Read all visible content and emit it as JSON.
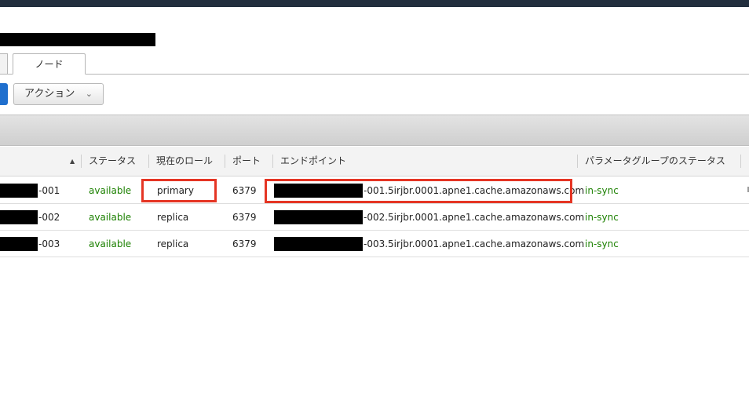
{
  "tabs": {
    "active_label": "ノード"
  },
  "toolbar": {
    "action_label": "アクション"
  },
  "table": {
    "columns": [
      "ステータス",
      "現在のロール",
      "ポート",
      "エンドポイント",
      "パラメータグループのステータス"
    ],
    "rows": [
      {
        "name_suffix": "-001",
        "status": "available",
        "role": "primary",
        "port": "6379",
        "endpoint_suffix": "-001.5irjbr.0001.apne1.cache.amazonaws.com",
        "param_status": "in-sync"
      },
      {
        "name_suffix": "-002",
        "status": "available",
        "role": "replica",
        "port": "6379",
        "endpoint_suffix": "-002.5irjbr.0001.apne1.cache.amazonaws.com",
        "param_status": "in-sync"
      },
      {
        "name_suffix": "-003",
        "status": "available",
        "role": "replica",
        "port": "6379",
        "endpoint_suffix": "-003.5irjbr.0001.apne1.cache.amazonaws.com",
        "param_status": "in-sync"
      }
    ]
  },
  "icons": {
    "sort": "sort-ascending-icon",
    "dropdown": "chevron-down-icon"
  },
  "colors": {
    "status_green": "#1d8102",
    "highlight_red": "#e53524",
    "primary_button_blue": "#1f6fce",
    "top_bar": "#232f3e"
  }
}
